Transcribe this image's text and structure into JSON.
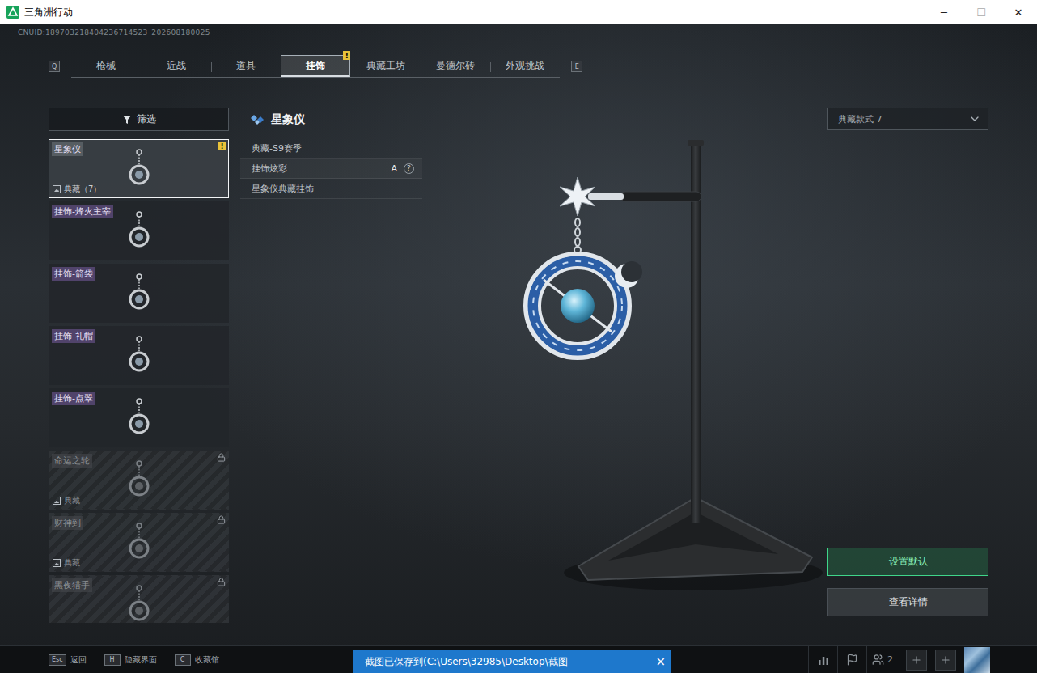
{
  "window": {
    "title": "三角洲行动",
    "controls": [
      "─",
      "☐",
      "✕"
    ]
  },
  "uid": "CNUID:189703218404236714523_202608180025",
  "tabs": {
    "prev_key": "Q",
    "next_key": "E",
    "items": [
      {
        "label": "枪械",
        "selected": false,
        "badge": ""
      },
      {
        "label": "近战",
        "selected": false,
        "badge": ""
      },
      {
        "label": "道具",
        "selected": false,
        "badge": ""
      },
      {
        "label": "挂饰",
        "selected": true,
        "badge": "!"
      },
      {
        "label": "典藏工坊",
        "selected": false,
        "badge": ""
      },
      {
        "label": "曼德尔砖",
        "selected": false,
        "badge": ""
      },
      {
        "label": "外观挑战",
        "selected": false,
        "badge": ""
      }
    ]
  },
  "filter": {
    "label": "筛选"
  },
  "items": [
    {
      "name": "星象仪",
      "sub": "典藏（7）",
      "selected": true,
      "locked": false,
      "badge": "!"
    },
    {
      "name": "挂饰-烽火主宰",
      "sub": "",
      "selected": false,
      "locked": false,
      "badge": ""
    },
    {
      "name": "挂饰-箭袋",
      "sub": "",
      "selected": false,
      "locked": false,
      "badge": ""
    },
    {
      "name": "挂饰-礼帽",
      "sub": "",
      "selected": false,
      "locked": false,
      "badge": ""
    },
    {
      "name": "挂饰-点翠",
      "sub": "",
      "selected": false,
      "locked": false,
      "badge": ""
    },
    {
      "name": "命运之轮",
      "sub": "典藏",
      "selected": false,
      "locked": true,
      "badge": ""
    },
    {
      "name": "财神到",
      "sub": "典藏",
      "selected": false,
      "locked": true,
      "badge": ""
    },
    {
      "name": "黑夜猎手",
      "sub": "",
      "selected": false,
      "locked": true,
      "badge": ""
    }
  ],
  "detail": {
    "title": "星象仪",
    "rows": [
      {
        "label": "典藏-S9赛季",
        "value": "",
        "help": ""
      },
      {
        "label": "挂饰炫彩",
        "value": "A",
        "help": "?"
      },
      {
        "label": "星象仪典藏挂饰",
        "value": "",
        "help": ""
      }
    ]
  },
  "style_select": {
    "value": "典藏款式 7"
  },
  "actions": [
    {
      "label": "设置默认",
      "primary": true
    },
    {
      "label": "查看详情",
      "primary": false
    }
  ],
  "key_hints": [
    {
      "key": "Esc",
      "label": "返回"
    },
    {
      "key": "H",
      "label": "隐藏界面"
    },
    {
      "key": "C",
      "label": "收藏馆"
    }
  ],
  "toast": {
    "text": "截图已保存到(C:\\Users\\32985\\Desktop\\截图",
    "close": "×"
  },
  "toolbar": {
    "party_count": "2"
  }
}
